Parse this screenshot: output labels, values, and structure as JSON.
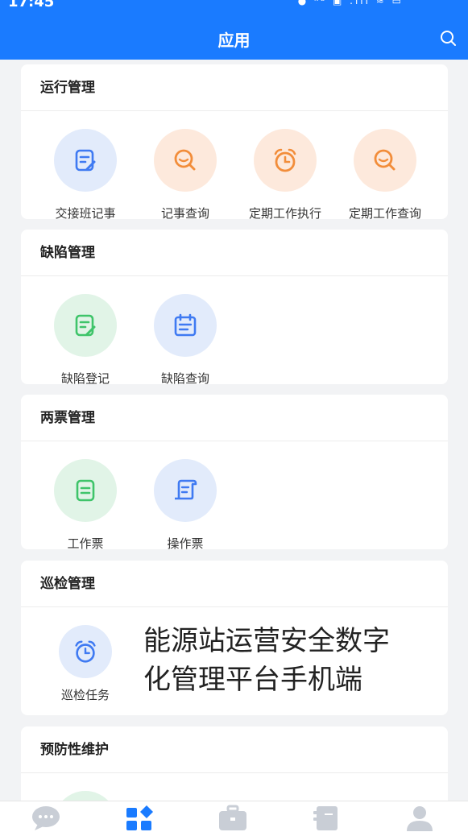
{
  "status": {
    "time": "17:45",
    "icons": "● ᴷᴮ ▣ .ıll ≈ ▭"
  },
  "header": {
    "title": "应用"
  },
  "sections": {
    "run": {
      "title": "运行管理",
      "items": [
        "交接班记事",
        "记事查询",
        "定期工作执行",
        "定期工作查询"
      ]
    },
    "defect": {
      "title": "缺陷管理",
      "items": [
        "缺陷登记",
        "缺陷查询"
      ]
    },
    "tickets": {
      "title": "两票管理",
      "items": [
        "工作票",
        "操作票"
      ]
    },
    "patrol": {
      "title": "巡检管理",
      "items": [
        "巡检任务"
      ]
    },
    "prevent": {
      "title": "预防性维护"
    }
  },
  "overlay": {
    "line1": "能源站运营安全数字",
    "line2": "化管理平台手机端"
  },
  "nav": {
    "icons": [
      "chat-icon",
      "apps-icon",
      "briefcase-icon",
      "ticket-icon",
      "user-icon"
    ]
  },
  "colors": {
    "primary": "#1a7bff",
    "blue_icon": "#3f7af2",
    "orange_icon": "#f28d3a",
    "green_icon": "#3fc46a",
    "nav_inactive": "#c9ced6"
  }
}
